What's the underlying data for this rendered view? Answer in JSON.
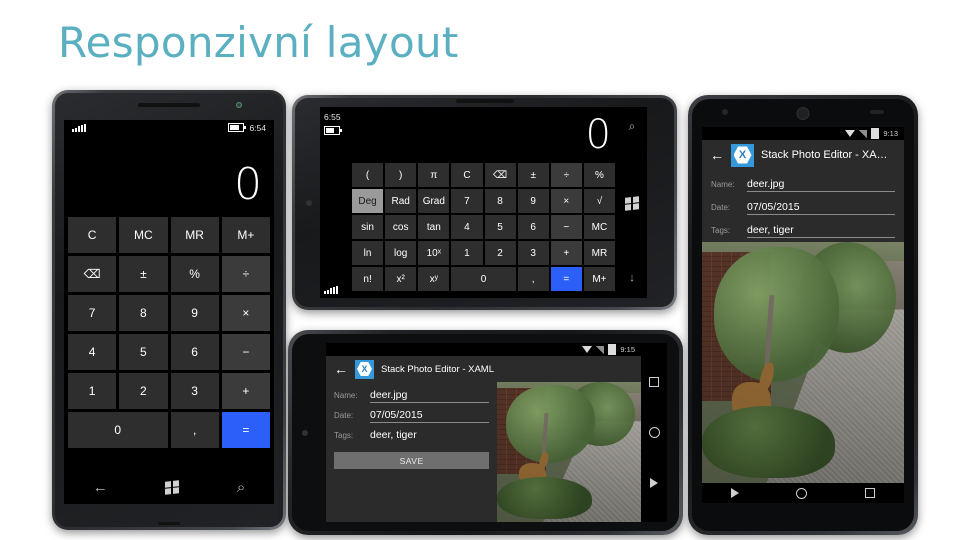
{
  "slide": {
    "title": "Responzivní layout",
    "title_color": "#5aafc0",
    "background_color": "#ffffff"
  },
  "windows_phone_portrait": {
    "device_name": "Windows Phone – portrait",
    "status": {
      "time": "6:54",
      "signal_icon": "signal-bars-icon",
      "battery_icon": "battery-icon"
    },
    "display_value": "0",
    "keys": [
      {
        "label": "C",
        "style": "fn"
      },
      {
        "label": "MC",
        "style": "fn"
      },
      {
        "label": "MR",
        "style": "fn"
      },
      {
        "label": "M+",
        "style": "fn"
      },
      {
        "label": "⌫",
        "style": "fn"
      },
      {
        "label": "±",
        "style": "fn"
      },
      {
        "label": "%",
        "style": "fn"
      },
      {
        "label": "÷",
        "style": "op"
      },
      {
        "label": "7",
        "style": "num"
      },
      {
        "label": "8",
        "style": "num"
      },
      {
        "label": "9",
        "style": "num"
      },
      {
        "label": "×",
        "style": "op"
      },
      {
        "label": "4",
        "style": "num"
      },
      {
        "label": "5",
        "style": "num"
      },
      {
        "label": "6",
        "style": "num"
      },
      {
        "label": "−",
        "style": "op"
      },
      {
        "label": "1",
        "style": "num"
      },
      {
        "label": "2",
        "style": "num"
      },
      {
        "label": "3",
        "style": "num"
      },
      {
        "label": "+",
        "style": "op"
      },
      {
        "label": "0",
        "style": "wide"
      },
      {
        "label": ",",
        "style": "num"
      },
      {
        "label": "=",
        "style": "eq"
      }
    ],
    "nav": [
      {
        "icon": "back-arrow-icon",
        "label": "←"
      },
      {
        "icon": "windows-logo-icon",
        "label": ""
      },
      {
        "icon": "search-icon",
        "label": "⌕"
      }
    ]
  },
  "windows_phone_landscape": {
    "device_name": "Windows Phone – landscape (scientific)",
    "status": {
      "time": "6:55",
      "battery_icon": "battery-icon",
      "signal_icon": "signal-bars-icon"
    },
    "display_value": "0",
    "keys": [
      {
        "label": "(",
        "style": "fn"
      },
      {
        "label": ")",
        "style": "fn"
      },
      {
        "label": "π",
        "style": "fn"
      },
      {
        "label": "C",
        "style": "fn"
      },
      {
        "label": "⌫",
        "style": "fn"
      },
      {
        "label": "±",
        "style": "fn"
      },
      {
        "label": "÷",
        "style": "op"
      },
      {
        "label": "%",
        "style": "fn"
      },
      {
        "label": "Deg",
        "style": "sel"
      },
      {
        "label": "Rad",
        "style": "fn"
      },
      {
        "label": "Grad",
        "style": "fn"
      },
      {
        "label": "7",
        "style": "num"
      },
      {
        "label": "8",
        "style": "num"
      },
      {
        "label": "9",
        "style": "num"
      },
      {
        "label": "×",
        "style": "op"
      },
      {
        "label": "√",
        "style": "fn"
      },
      {
        "label": "sin",
        "style": "fn"
      },
      {
        "label": "cos",
        "style": "fn"
      },
      {
        "label": "tan",
        "style": "fn"
      },
      {
        "label": "4",
        "style": "num"
      },
      {
        "label": "5",
        "style": "num"
      },
      {
        "label": "6",
        "style": "num"
      },
      {
        "label": "−",
        "style": "op"
      },
      {
        "label": "MC",
        "style": "fn"
      },
      {
        "label": "ln",
        "style": "fn"
      },
      {
        "label": "log",
        "style": "fn"
      },
      {
        "label": "10ˣ",
        "style": "fn"
      },
      {
        "label": "1",
        "style": "num"
      },
      {
        "label": "2",
        "style": "num"
      },
      {
        "label": "3",
        "style": "num"
      },
      {
        "label": "+",
        "style": "op"
      },
      {
        "label": "MR",
        "style": "fn"
      },
      {
        "label": "n!",
        "style": "fn"
      },
      {
        "label": "x²",
        "style": "fn"
      },
      {
        "label": "xʸ",
        "style": "fn"
      },
      {
        "label": "0",
        "style": "wide"
      },
      {
        "label": ",",
        "style": "num"
      },
      {
        "label": "=",
        "style": "eq"
      },
      {
        "label": "M+",
        "style": "fn"
      }
    ],
    "nav": [
      {
        "icon": "search-icon",
        "label": "⌕"
      },
      {
        "icon": "windows-logo-icon",
        "label": ""
      },
      {
        "icon": "down-arrow-icon",
        "label": "↓"
      }
    ]
  },
  "android_landscape": {
    "device_name": "Android – landscape",
    "status": {
      "time": "9:15",
      "wifi_icon": "wifi-icon",
      "signal_icon": "signal-icon",
      "battery_icon": "battery-icon"
    },
    "app_title": "Stack Photo Editor - XAML",
    "logo_letter": "X",
    "back_icon": "back-arrow-icon",
    "fields": [
      {
        "label": "Name:",
        "value": "deer.jpg",
        "underlined": true
      },
      {
        "label": "Date:",
        "value": "07/05/2015",
        "underlined": true
      },
      {
        "label": "Tags:",
        "value": "deer, tiger",
        "underlined": false
      }
    ],
    "save_label": "SAVE",
    "nav": [
      {
        "icon": "recents-square-icon"
      },
      {
        "icon": "home-circle-icon"
      },
      {
        "icon": "back-triangle-icon"
      }
    ]
  },
  "android_portrait": {
    "device_name": "Android – portrait",
    "status": {
      "time": "9:13",
      "wifi_icon": "wifi-icon",
      "signal_icon": "signal-icon",
      "battery_icon": "battery-icon"
    },
    "app_title": "Stack Photo Editor - XA…",
    "logo_letter": "X",
    "back_icon": "back-arrow-icon",
    "fields": [
      {
        "label": "Name:",
        "value": "deer.jpg",
        "underlined": true
      },
      {
        "label": "Date:",
        "value": "07/05/2015",
        "underlined": true
      },
      {
        "label": "Tags:",
        "value": "deer, tiger",
        "underlined": true
      }
    ],
    "nav": [
      {
        "icon": "back-triangle-icon"
      },
      {
        "icon": "home-circle-icon"
      },
      {
        "icon": "recents-square-icon"
      }
    ]
  }
}
